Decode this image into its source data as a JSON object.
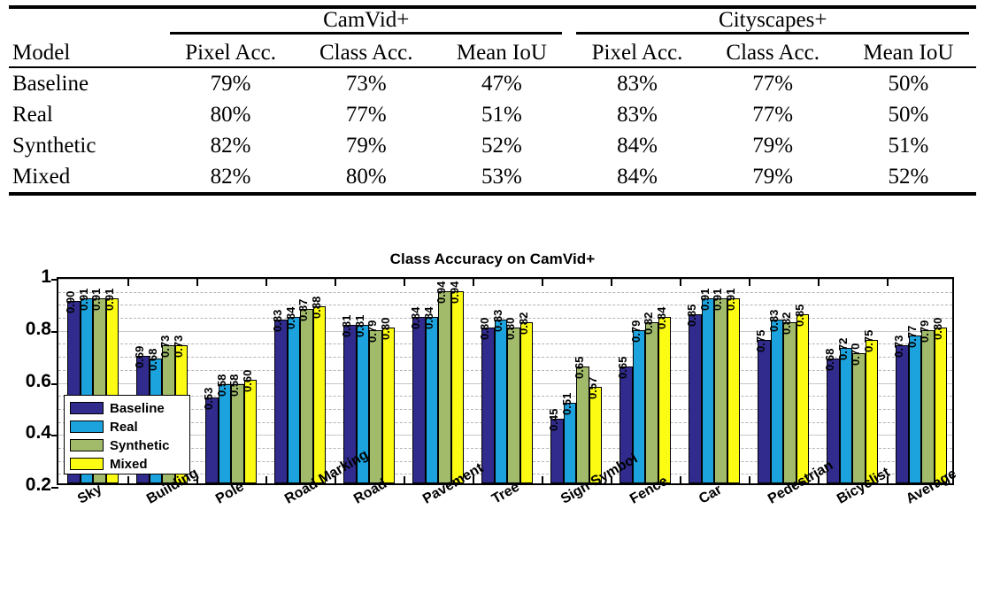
{
  "table": {
    "group_headers": [
      "",
      "CamVid+",
      "Cityscapes+"
    ],
    "columns": [
      "Model",
      "Pixel Acc.",
      "Class Acc.",
      "Mean IoU",
      "Pixel Acc.",
      "Class Acc.",
      "Mean IoU"
    ],
    "rows": [
      {
        "model": "Baseline",
        "cells": [
          "79%",
          "73%",
          "47%",
          "83%",
          "77%",
          "50%"
        ],
        "bold": [
          false,
          false,
          false,
          false,
          false,
          false
        ]
      },
      {
        "model": "Real",
        "cells": [
          "80%",
          "77%",
          "51%",
          "83%",
          "77%",
          "50%"
        ],
        "bold": [
          false,
          false,
          false,
          false,
          false,
          false
        ]
      },
      {
        "model": "Synthetic",
        "cells": [
          "82%",
          "79%",
          "52%",
          "84%",
          "79%",
          "51%"
        ],
        "bold": [
          true,
          false,
          false,
          true,
          true,
          false
        ]
      },
      {
        "model": "Mixed",
        "cells": [
          "82%",
          "80%",
          "53%",
          "84%",
          "79%",
          "52%"
        ],
        "bold": [
          true,
          true,
          true,
          true,
          true,
          true
        ]
      }
    ]
  },
  "chart_data": {
    "type": "bar",
    "title": "Class Accuracy on CamVid+",
    "xlabel": "",
    "ylabel": "",
    "ylim": [
      0.2,
      1
    ],
    "yticks": [
      "0.2",
      "0.4",
      "0.6",
      "0.8",
      "1"
    ],
    "grid": true,
    "legend_position": "inside-left",
    "categories": [
      "Sky",
      "Building",
      "Pole",
      "Road Marking",
      "Road",
      "Pavement",
      "Tree",
      "Sign Symbol",
      "Fence",
      "Car",
      "Pedestrian",
      "Bicyclist",
      "Average"
    ],
    "series": [
      {
        "name": "Baseline",
        "color": "#302b8c",
        "values": [
          0.9,
          0.69,
          0.53,
          0.83,
          0.81,
          0.84,
          0.8,
          0.45,
          0.65,
          0.85,
          0.75,
          0.68,
          0.73
        ],
        "labels": [
          "0.90",
          "0.69",
          "0.53",
          "0.83",
          "0.81",
          "0.84",
          "0.80",
          "0.45",
          "0.65",
          "0.85",
          "0.75",
          "0.68",
          "0.73"
        ]
      },
      {
        "name": "Real",
        "color": "#1ca3dd",
        "values": [
          0.91,
          0.68,
          0.58,
          0.84,
          0.81,
          0.84,
          0.83,
          0.51,
          0.79,
          0.91,
          0.83,
          0.72,
          0.77
        ],
        "labels": [
          "0.91",
          "0.68",
          "0.58",
          "0.84",
          "0.81",
          "0.84",
          "0.83",
          "0.51",
          "0.79",
          "0.91",
          "0.83",
          "0.72",
          "0.77"
        ]
      },
      {
        "name": "Synthetic",
        "color": "#a2bb6a",
        "values": [
          0.91,
          0.73,
          0.58,
          0.87,
          0.79,
          0.94,
          0.8,
          0.65,
          0.82,
          0.91,
          0.82,
          0.7,
          0.79
        ],
        "labels": [
          "0.91",
          "0.73",
          "0.58",
          "0.87",
          "0.79",
          "0.94",
          "0.80",
          "0.65",
          "0.82",
          "0.91",
          "0.82",
          "0.70",
          "0.79"
        ]
      },
      {
        "name": "Mixed",
        "color": "#fbfb13",
        "values": [
          0.91,
          0.73,
          0.6,
          0.88,
          0.8,
          0.94,
          0.82,
          0.57,
          0.84,
          0.91,
          0.85,
          0.75,
          0.8
        ],
        "labels": [
          "0.91",
          "0.73",
          "0.60",
          "0.88",
          "0.80",
          "0.94",
          "0.82",
          "0.57",
          "0.84",
          "0.91",
          "0.85",
          "0.75",
          "0.80"
        ]
      }
    ]
  }
}
